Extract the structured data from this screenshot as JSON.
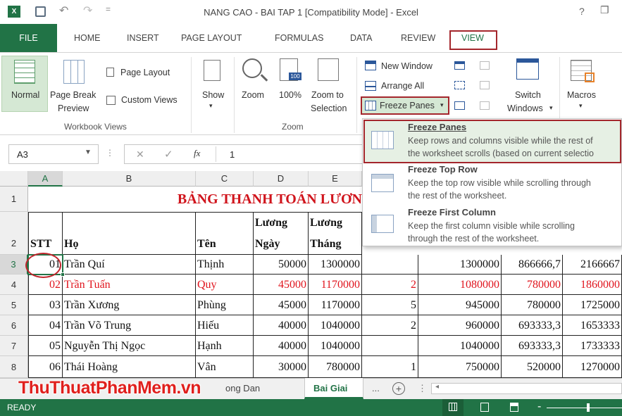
{
  "window": {
    "title": "NANG CAO - BAI TAP 1  [Compatibility Mode] - Excel",
    "help": "?",
    "restore": "❐"
  },
  "tabs": [
    "FILE",
    "HOME",
    "INSERT",
    "PAGE LAYOUT",
    "FORMULAS",
    "DATA",
    "REVIEW",
    "VIEW"
  ],
  "ribbon": {
    "normal": "Normal",
    "page_break_1": "Page Break",
    "page_break_2": "Preview",
    "page_layout": "Page Layout",
    "custom_views": "Custom Views",
    "group_workbook_views": "Workbook Views",
    "show": "Show",
    "zoom": "Zoom",
    "zoom100": "100%",
    "zoom100_icon": "100",
    "zoom_to_1": "Zoom to",
    "zoom_to_2": "Selection",
    "group_zoom": "Zoom",
    "new_window": "New Window",
    "arrange_all": "Arrange All",
    "freeze_panes": "Freeze Panes",
    "switch_1": "Switch",
    "switch_2": "Windows",
    "macros": "Macros"
  },
  "formula_bar": {
    "name_box": "A3",
    "cancel": "✕",
    "enter": "✓",
    "fx": "fx",
    "value": "1"
  },
  "grid": {
    "col_headers": [
      "A",
      "B",
      "C",
      "D",
      "E"
    ],
    "row_headers": [
      "1",
      "2",
      "3",
      "4",
      "5",
      "6",
      "7",
      "8"
    ],
    "title": "BẢNG THANH TOÁN LƯƠN",
    "header_row": {
      "stt": "STT",
      "ho": "Họ",
      "ten": "Tên",
      "luong_ngay_1": "Lương",
      "luong_ngay_2": "Ngày",
      "luong_thang_1": "Lương",
      "luong_thang_2": "Tháng"
    },
    "rows": [
      {
        "stt": "01",
        "ho": "Trần Quí",
        "ten": "Thịnh",
        "d": "50000",
        "e": "1300000",
        "f": "",
        "g": "1300000",
        "h": "866666,7",
        "i": "2166667"
      },
      {
        "stt": "02",
        "ho": "Trần Tuấn",
        "ten": "Quy",
        "d": "45000",
        "e": "1170000",
        "f": "2",
        "g": "1080000",
        "h": "780000",
        "i": "1860000"
      },
      {
        "stt": "03",
        "ho": "Trần Xương",
        "ten": "Phùng",
        "d": "45000",
        "e": "1170000",
        "f": "5",
        "g": "945000",
        "h": "780000",
        "i": "1725000"
      },
      {
        "stt": "04",
        "ho": "Trần Võ Trung",
        "ten": "Hiếu",
        "d": "40000",
        "e": "1040000",
        "f": "2",
        "g": "960000",
        "h": "693333,3",
        "i": "1653333"
      },
      {
        "stt": "05",
        "ho": "Nguyễn Thị Ngọc",
        "ten": "Hạnh",
        "d": "40000",
        "e": "1040000",
        "f": "",
        "g": "1040000",
        "h": "693333,3",
        "i": "1733333"
      },
      {
        "stt": "06",
        "ho": "Thái Hoàng",
        "ten": "Vân",
        "d": "30000",
        "e": "780000",
        "f": "1",
        "g": "750000",
        "h": "520000",
        "i": "1270000"
      }
    ]
  },
  "dropdown": {
    "items": [
      {
        "title": "Freeze Panes",
        "desc1": "Keep rows and columns visible while the rest of",
        "desc2": "the worksheet scrolls (based on current selectio"
      },
      {
        "title": "Freeze Top Row",
        "desc1": "Keep the top row visible while scrolling through",
        "desc2": "the rest of the worksheet."
      },
      {
        "title": "Freeze First Column",
        "desc1": "Keep the first column visible while scrolling",
        "desc2": "through the rest of the worksheet."
      }
    ]
  },
  "sheets": {
    "partial": "ong Dan",
    "active": "Bai Giai",
    "more": "...",
    "add": "+"
  },
  "watermark": "ThuThuatPhanMem.vn",
  "status": {
    "ready": "READY"
  },
  "colors": {
    "excel_green": "#217346",
    "title_red": "#d0141c",
    "highlight_border": "#a4262c"
  }
}
